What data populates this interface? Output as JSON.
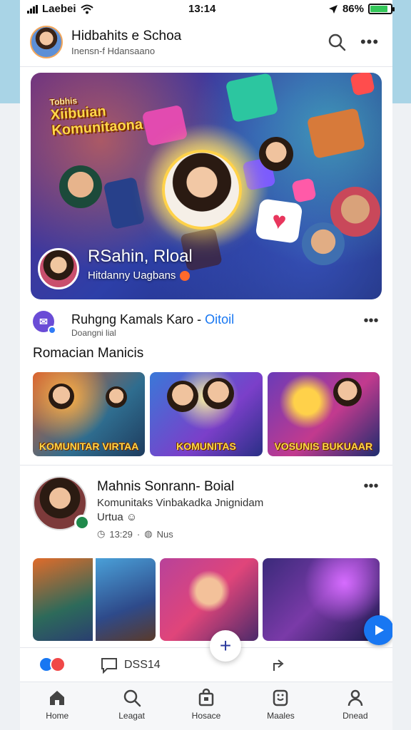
{
  "status_bar": {
    "carrier": "Laebei",
    "time": "13:14",
    "battery": "86%"
  },
  "header": {
    "title": "Hidbahits e Schoa",
    "subtitle": "Inensn-f Hdansaano"
  },
  "hero": {
    "logo_line1": "Tobhis",
    "logo_line2": "Xiibuian",
    "logo_line3": "Komunitaona",
    "name": "RSahin, Rloal",
    "subtitle": "Hitdanny Uagbans"
  },
  "post1": {
    "author": "Ruhgng Kamals Karo -",
    "author_tag": "Oitoil",
    "sub": "Doangni lial",
    "section_label": "Romacian Manicis",
    "media": [
      {
        "caption": "KOMUNITAR VIRTAA"
      },
      {
        "caption": "KOMUNITAS"
      },
      {
        "caption": "VOSUNIS BUKUAAR"
      }
    ]
  },
  "post2": {
    "author": "Mahnis Sonrann- Boial",
    "body_line1": "Komunitaks Vinbakadka Jnignidam",
    "body_line2": "Urtua",
    "time": "13:29",
    "meta": "Nus"
  },
  "reaction_bar": {
    "comment_count": "DSS14"
  },
  "bottom_nav": {
    "items": [
      {
        "label": "Home"
      },
      {
        "label": "Leagat"
      },
      {
        "label": "Hosace"
      },
      {
        "label": "Maales"
      },
      {
        "label": "Dnead"
      }
    ]
  },
  "colors": {
    "accent": "#1877f2",
    "battery": "#34c759",
    "heart": "#e8365d"
  }
}
